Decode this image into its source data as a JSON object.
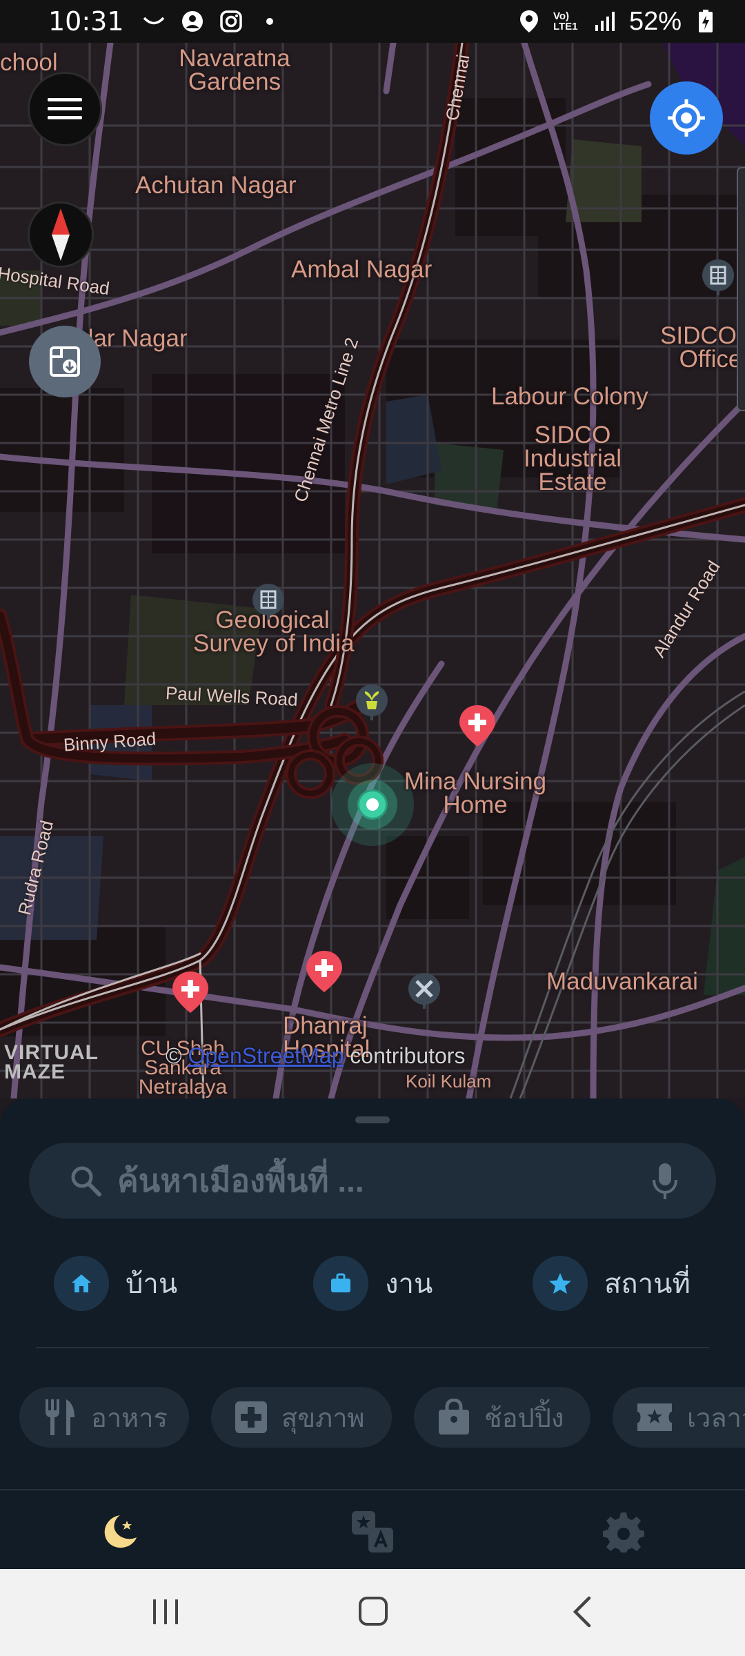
{
  "status_bar": {
    "time": "10:31",
    "battery": "52%",
    "network": "Vo) LTE1"
  },
  "map": {
    "places": [
      {
        "label": "Navaratna\nGardens"
      },
      {
        "label": "Achutan Nagar"
      },
      {
        "label": "Ambal Nagar"
      },
      {
        "label": "dar Nagar"
      },
      {
        "label": "Labour Colony"
      },
      {
        "label": "SIDCO\nIndustrial\nEstate"
      },
      {
        "label": "SIDCO H\nOffice"
      },
      {
        "label": "Geological\nSurvey of India"
      },
      {
        "label": "Mina Nursing\nHome"
      },
      {
        "label": "Maduvankarai"
      },
      {
        "label": "Dhanraj\nHospital"
      },
      {
        "label": "CU Shah\nSankara\nNetralaya"
      },
      {
        "label": "Koil Kulam"
      },
      {
        "label": "chool"
      }
    ],
    "roads": [
      {
        "label": "Hospital Road"
      },
      {
        "label": "Chennai Metro Line 2"
      },
      {
        "label": "Chennai"
      },
      {
        "label": "Paul Wells Road"
      },
      {
        "label": "Binny Road"
      },
      {
        "label": "Rudra Road"
      },
      {
        "label": "Alandur Road"
      }
    ],
    "logo_text": "VIRTUAL\nMAZE",
    "attribution_prefix": "© ",
    "attribution_link": "OpenStreetMap",
    "attribution_suffix": " contributors"
  },
  "sheet": {
    "search_placeholder": "ค้นหาเมืองพื้นที่ ...",
    "quick": [
      {
        "label": "บ้าน",
        "icon": "home-icon"
      },
      {
        "label": "งาน",
        "icon": "briefcase-icon"
      },
      {
        "label": "สถานที่",
        "icon": "star-icon"
      }
    ],
    "chips": [
      {
        "label": "อาหาร",
        "icon": "fork-knife-icon"
      },
      {
        "label": "สุขภาพ",
        "icon": "medical-cross-icon"
      },
      {
        "label": "ช้อปปิ้ง",
        "icon": "shopping-bag-icon"
      },
      {
        "label": "เวลาว",
        "icon": "ticket-icon"
      }
    ]
  },
  "colors": {
    "accent_blue": "#2f80ed",
    "hospital_pin": "#ef4b5b",
    "current_location": "#3ccfa4",
    "sheet_bg": "#121c26",
    "place_label": "#d69a86"
  }
}
